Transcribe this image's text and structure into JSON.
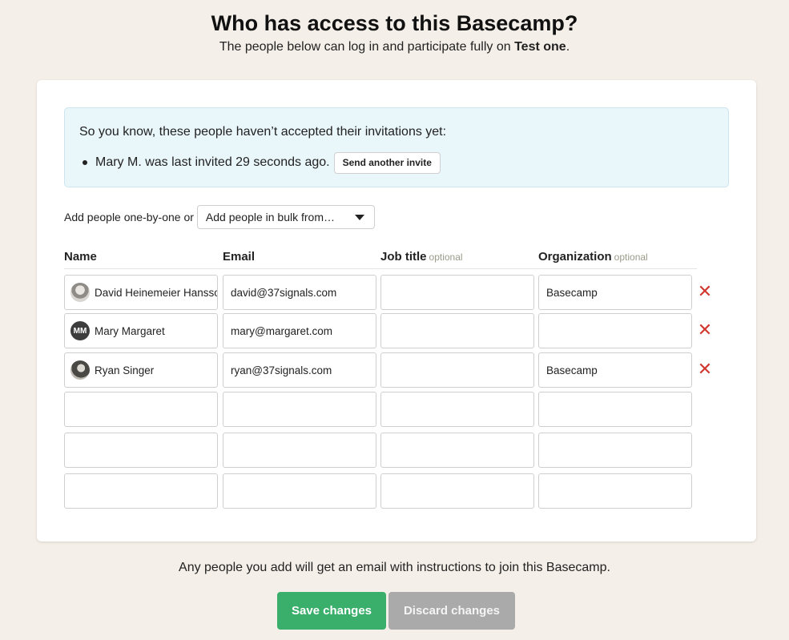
{
  "header": {
    "title": "Who has access to this Basecamp?",
    "subtitle_prefix": "The people below can log in and participate fully on ",
    "project_name": "Test one",
    "subtitle_suffix": "."
  },
  "notice": {
    "text": "So you know, these people haven’t accepted their invitations yet:",
    "item_text": "Mary M. was last invited 29 seconds ago.",
    "resend_label": "Send another invite"
  },
  "add": {
    "label": "Add people one-by-one or",
    "bulk_label": "Add people in bulk from…"
  },
  "table": {
    "headers": {
      "name": "Name",
      "email": "Email",
      "job_title": "Job title",
      "organization": "Organization",
      "optional": "optional"
    },
    "rows": [
      {
        "name": "David Heinemeier Hansson",
        "email": "david@37signals.com",
        "job_title": "",
        "organization": "Basecamp",
        "avatar": "photo",
        "initials": ""
      },
      {
        "name": "Mary Margaret",
        "email": "mary@margaret.com",
        "job_title": "",
        "organization": "",
        "avatar": "initials",
        "initials": "MM"
      },
      {
        "name": "Ryan Singer",
        "email": "ryan@37signals.com",
        "job_title": "",
        "organization": "Basecamp",
        "avatar": "photo",
        "initials": ""
      }
    ],
    "empty_rows": 3,
    "remove_icon": "close-x-icon"
  },
  "footer": {
    "note": "Any people you add will get an email with instructions to join this Basecamp.",
    "save_label": "Save changes",
    "discard_label": "Discard changes"
  },
  "colors": {
    "background": "#f4efe8",
    "notice_bg": "#e9f6fa",
    "save_button": "#3aae6b",
    "discard_button": "#aaaaaa",
    "remove_icon": "#d0372e",
    "optional_text": "#9a9a8a"
  }
}
